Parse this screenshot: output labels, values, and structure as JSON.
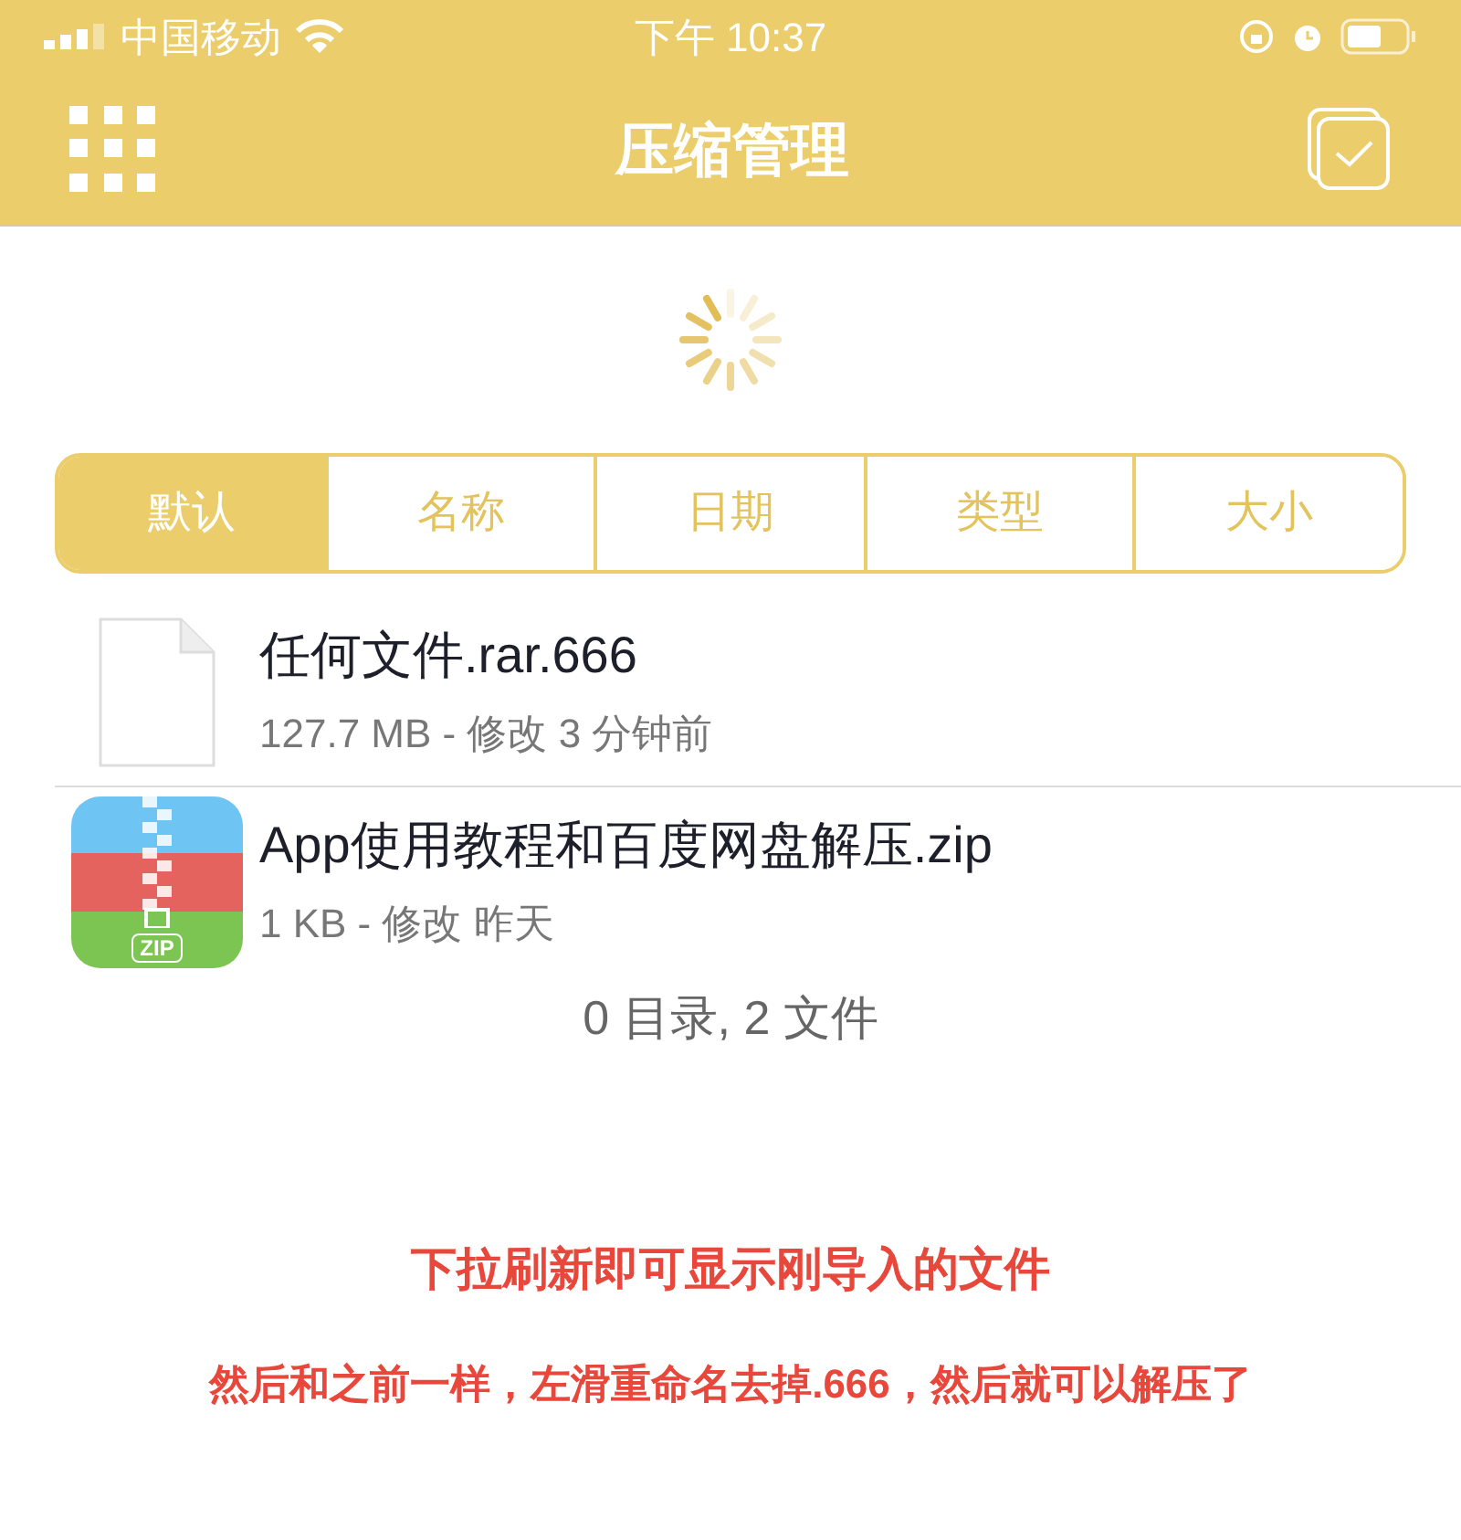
{
  "status_bar": {
    "carrier": "中国移动",
    "time": "下午 10:37"
  },
  "nav": {
    "title": "压缩管理"
  },
  "sort_tabs": [
    {
      "label": "默认",
      "selected": true
    },
    {
      "label": "名称",
      "selected": false
    },
    {
      "label": "日期",
      "selected": false
    },
    {
      "label": "类型",
      "selected": false
    },
    {
      "label": "大小",
      "selected": false
    }
  ],
  "files": [
    {
      "kind": "document",
      "name": "任何文件.rar.666",
      "details": "127.7 MB - 修改 3 分钟前"
    },
    {
      "kind": "zip",
      "name": "App使用教程和百度网盘解压.zip",
      "details": "1 KB - 修改 昨天",
      "icon_label": "ZIP"
    }
  ],
  "summary": "0 目录, 2 文件",
  "notes": [
    "下拉刷新即可显示刚导入的文件",
    "然后和之前一样，左滑重命名去掉.666，然后就可以解压了"
  ]
}
